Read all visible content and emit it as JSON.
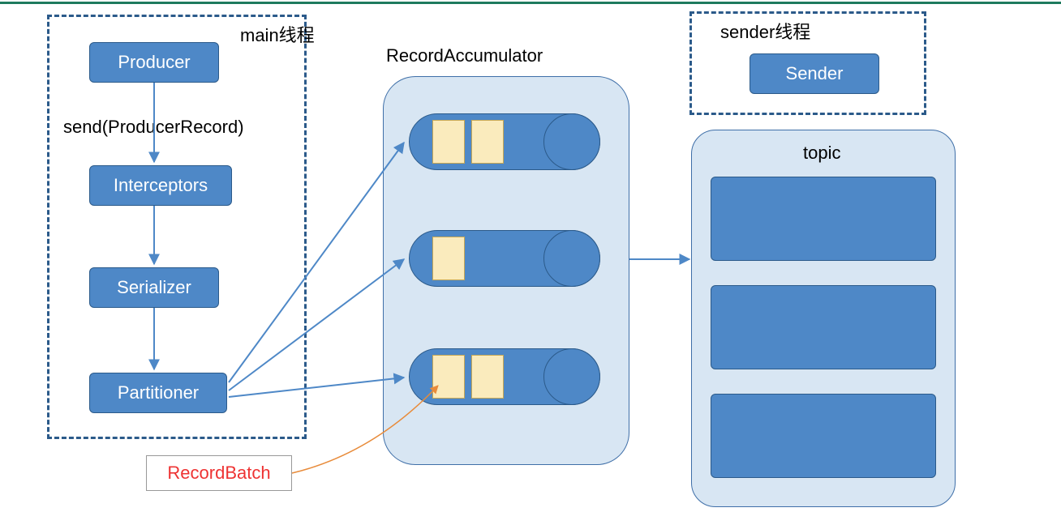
{
  "labels": {
    "mainThread": "main线程",
    "senderThread": "sender线程",
    "producer": "Producer",
    "send": "send(ProducerRecord)",
    "interceptors": "Interceptors",
    "serializer": "Serializer",
    "partitioner": "Partitioner",
    "recordAccumulator": "RecordAccumulator",
    "sender": "Sender",
    "topic": "topic",
    "recordBatch": "RecordBatch"
  },
  "colors": {
    "boxFill": "#4e88c7",
    "boxBorder": "#2b5a8a",
    "lightFill": "#d8e6f3",
    "batchFill": "#faebbd",
    "orangeLine": "#e88b3a",
    "redText": "#e33"
  }
}
